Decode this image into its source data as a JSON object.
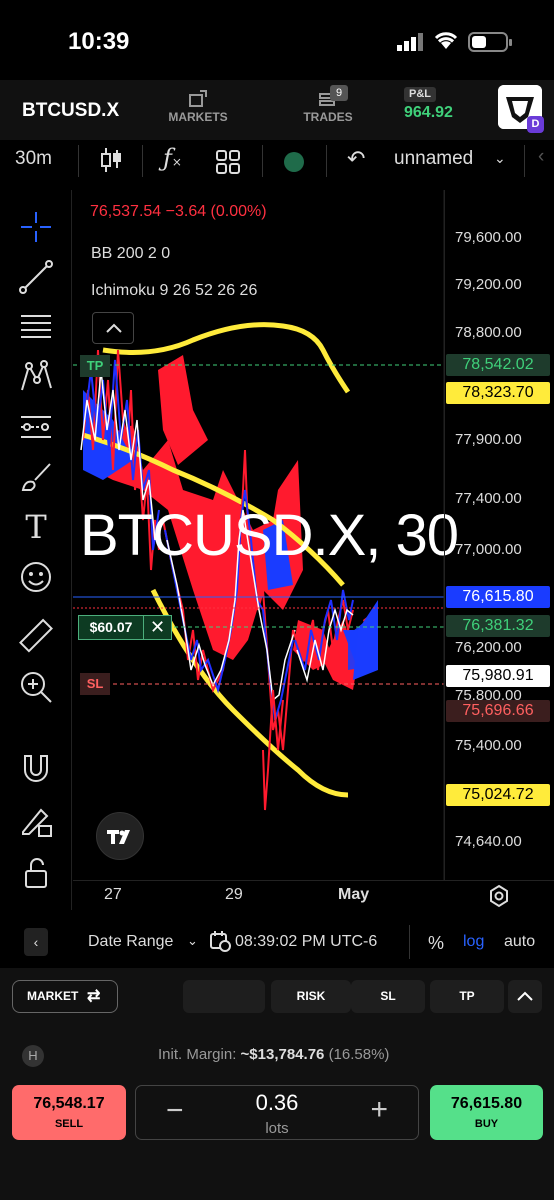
{
  "status_bar": {
    "time": "10:39"
  },
  "header": {
    "symbol": "BTCUSD.X",
    "nav": [
      {
        "label": "MARKETS",
        "icon": "markets-icon"
      },
      {
        "label": "TRADES",
        "icon": "trades-icon",
        "badge": "9"
      }
    ],
    "pnl": {
      "label": "P&L",
      "value": "964.92",
      "color": "#3fd07a"
    },
    "avatar_badge": "D"
  },
  "toolbar": {
    "interval": "30m",
    "layout_name": "unnamed",
    "icons": [
      "candles-icon",
      "indicators-icon",
      "templates-icon",
      "status-dot-icon",
      "undo-icon",
      "chevron-down-icon"
    ]
  },
  "chart": {
    "info": {
      "price_line": "76,537.54  −3.64 (0.00%)",
      "bb": "BB 200 2 0",
      "ichimoku": "Ichimoku 9 26 52 26 26"
    },
    "watermark": "BTCUSD.X, 30",
    "position_pnl": "$60.07",
    "tp_label": "TP",
    "sl_label": "SL",
    "y_ticks": [
      "79,600.00",
      "79,200.00",
      "78,800.00",
      "77,900.00",
      "77,400.00",
      "77,000.00",
      "76,200.00",
      "75,800.00",
      "75,400.00",
      "74,640.00"
    ],
    "price_labels": [
      {
        "text": "78,542.02",
        "bg": "#1e3b2c",
        "fg": "#3fd07a"
      },
      {
        "text": "78,323.70",
        "bg": "#ffeb3b",
        "fg": "#000"
      },
      {
        "text": "76,615.80",
        "bg": "#1a3cff",
        "fg": "#fff"
      },
      {
        "text": "76,381.32",
        "bg": "#1e3b2c",
        "fg": "#3fd07a"
      },
      {
        "text": "75,980.91",
        "bg": "#ffffff",
        "fg": "#000"
      },
      {
        "text": "75,696.66",
        "bg": "#3b1e1e",
        "fg": "#ff6060"
      },
      {
        "text": "75,024.72",
        "bg": "#ffeb3b",
        "fg": "#000"
      }
    ],
    "x_ticks": [
      "27",
      "29",
      "May"
    ]
  },
  "bottom_bar": {
    "range_label": "Date Range",
    "clock": "08:39:02 PM UTC-6",
    "pct": "%",
    "log": "log",
    "auto": "auto"
  },
  "order_panel": {
    "order_type": "MARKET",
    "buttons": [
      "RISK",
      "SL",
      "TP"
    ],
    "margin_label": "Init. Margin:",
    "margin_value": "~$13,784.76",
    "margin_pct": "(16.58%)",
    "sell_price": "76,548.17",
    "sell_label": "SELL",
    "buy_price": "76,615.80",
    "buy_label": "BUY",
    "lots_value": "0.36",
    "lots_unit": "lots"
  }
}
